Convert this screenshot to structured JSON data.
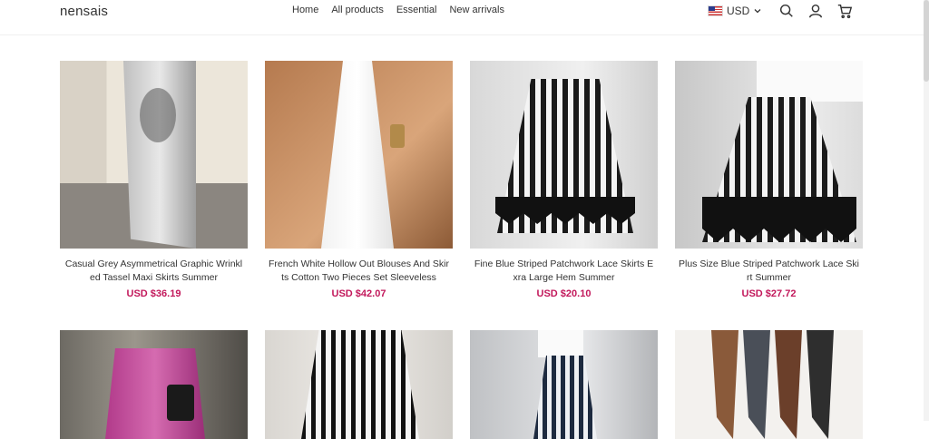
{
  "header": {
    "logo": "nensais",
    "nav": [
      "Home",
      "All products",
      "Essential",
      "New arrivals"
    ],
    "currency": "USD",
    "icons": [
      "search-icon",
      "account-icon",
      "cart-icon"
    ]
  },
  "products": [
    {
      "title": "Casual Grey Asymmetrical Graphic Wrinkled Tassel Maxi Skirts Summer",
      "price": "USD $36.19"
    },
    {
      "title": "French White Hollow Out Blouses And Skirts Cotton Two Pieces Set Sleeveless",
      "price": "USD $42.07"
    },
    {
      "title": "Fine Blue Striped Patchwork Lace Skirts Exra Large Hem Summer",
      "price": "USD $20.10"
    },
    {
      "title": "Plus Size Blue Striped Patchwork Lace Skirt Summer",
      "price": "USD $27.72"
    }
  ],
  "colors": {
    "price": "#c2185b"
  }
}
